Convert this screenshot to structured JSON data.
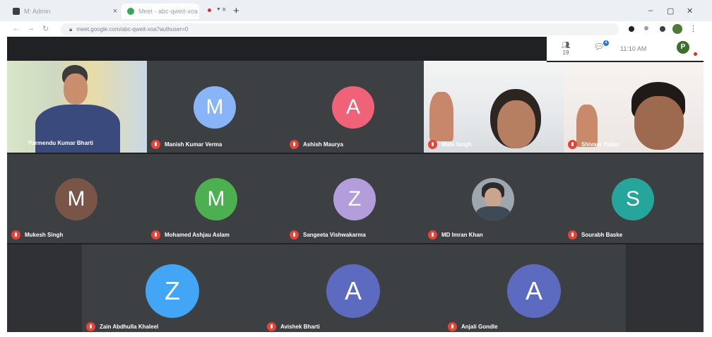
{
  "browser": {
    "tabs": [
      {
        "title": "M: Admin"
      },
      {
        "title": "Meet - abc-qweit-xoa"
      }
    ],
    "url": "meet.google.com/abc-qweit-xoa?authuser=0"
  },
  "meet": {
    "toolbar": {
      "people_count": "19",
      "chat_badge": "4",
      "time": "11:10 AM",
      "profile_initial": "P"
    },
    "participants": [
      {
        "name": "Parmendu Kumar Bharti",
        "type": "video"
      },
      {
        "name": "Manish Kumar Verma",
        "initial": "M",
        "color": "#8ab4f8"
      },
      {
        "name": "Ashish Maurya",
        "initial": "A",
        "color": "#f06277"
      },
      {
        "name": "Mahi Singh",
        "type": "video"
      },
      {
        "name": "Shivam Yadav",
        "type": "video"
      },
      {
        "name": "Mukesh Singh",
        "initial": "M",
        "color": "#795548"
      },
      {
        "name": "Mohamed Ashjau Aslam",
        "initial": "M",
        "color": "#4caf50"
      },
      {
        "name": "Sangeeta Vishwakarma",
        "initial": "Z",
        "color": "#b39ddb"
      },
      {
        "name": "MD Imran Khan",
        "type": "photo"
      },
      {
        "name": "Sourabh Baske",
        "initial": "S",
        "color": "#26a69a"
      },
      {
        "name": "Zain Abdhulla Khaleel",
        "initial": "Z",
        "color": "#42a5f5"
      },
      {
        "name": "Avishek Bharti",
        "initial": "A",
        "color": "#5c6bc0"
      },
      {
        "name": "Anjali Gondle",
        "initial": "A",
        "color": "#5c6bc0"
      }
    ]
  }
}
